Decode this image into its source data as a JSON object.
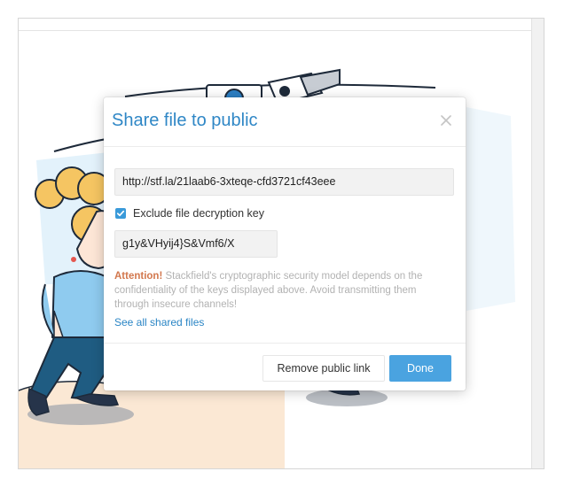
{
  "modal": {
    "title": "Share file to public",
    "public_url": "http://stf.la/21laab6-3xteqe-cfd3721cf43eee",
    "exclude_key_label": "Exclude file decryption key",
    "exclude_key_checked": true,
    "decryption_key": "g1y&VHyij4}S&Vmf6/X",
    "attention_label": "Attention!",
    "attention_text": " Stackfield's cryptographic security model depends on the confidentiality of the keys displayed above. Avoid transmitting them through insecure channels!",
    "see_all_link": "See all shared files",
    "remove_button": "Remove public link",
    "done_button": "Done"
  },
  "icons": {
    "close": "close-icon",
    "checkbox": "checkmark-icon"
  },
  "colors": {
    "accent": "#2f87c6",
    "primary_button": "#4aa3e0",
    "attention": "#d2774d",
    "hint_text": "#b2b2b2"
  }
}
